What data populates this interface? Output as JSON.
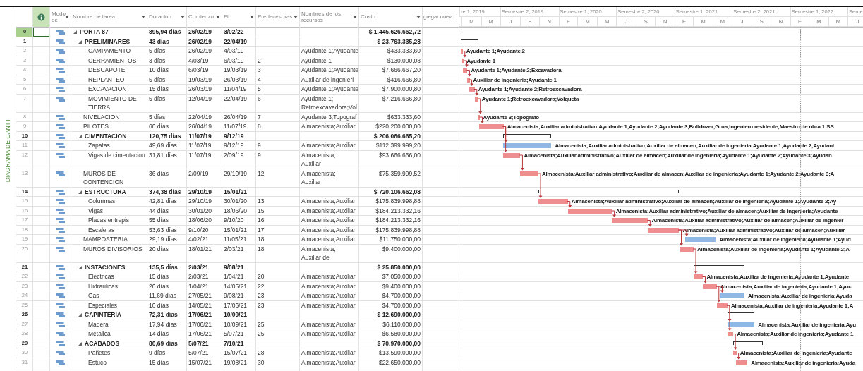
{
  "side_label": "DIAGRAMA DE GANTT",
  "columns": [
    {
      "label": "Modo de",
      "dropdown": true
    },
    {
      "label": "Nombre de tarea",
      "dropdown": true
    },
    {
      "label": "Duración",
      "dropdown": true
    },
    {
      "label": "Comienzo",
      "dropdown": true
    },
    {
      "label": "Fin",
      "dropdown": true
    },
    {
      "label": "Predecesoras",
      "dropdown": true
    },
    {
      "label": "Nombres de los recursos",
      "dropdown": true
    },
    {
      "label": "Costo",
      "dropdown": true
    },
    {
      "label": "gregar nuevo",
      "dropdown": false
    }
  ],
  "timescale": {
    "semesters": [
      "re 1, 2019",
      "Semestre 2, 2019",
      "Semestre 1, 2020",
      "Semestre 2, 2020",
      "Semestre 1, 2021",
      "Semestre 2, 2021",
      "Semestre 1, 2022",
      "Seme"
    ],
    "months": [
      "M",
      "M",
      "J",
      "S",
      "N",
      "E",
      "M",
      "M",
      "J",
      "S",
      "N",
      "E",
      "M",
      "M",
      "J",
      "S",
      "N",
      "E",
      "M",
      "M",
      "J"
    ]
  },
  "tasks": [
    {
      "id": "0",
      "kind": "project",
      "name": "PORTA 87",
      "duration": "895,94 días",
      "start": "26/02/19",
      "finish": "3/02/22",
      "cost": "$ 1.445.626.662,72",
      "expanded": true,
      "selected": true,
      "children": [
        {
          "id": "1",
          "kind": "summary",
          "name": "PRELIMINARES",
          "duration": "43 días",
          "start": "26/02/19",
          "finish": "22/04/19",
          "cost": "$ 23.763.335,28",
          "expanded": true,
          "selected": false,
          "children": [
            {
              "id": "2",
              "kind": "task",
              "name": "CAMPAMENTO",
              "duration": "5 días",
              "start": "26/02/19",
              "finish": "4/03/19",
              "resources": "Ayudante 1;Ayudante",
              "cost": "$433.333,60",
              "critical": true,
              "selected": false,
              "bar_label": "Ayudante 1;Ayudante 2"
            },
            {
              "id": "3",
              "kind": "task",
              "name": "CERRAMIENTOS",
              "duration": "3 días",
              "start": "4/03/19",
              "finish": "6/03/19",
              "predecessors": "2",
              "resources": "Ayudante 1",
              "cost": "$130.000,08",
              "critical": true,
              "selected": false,
              "bar_label": "Ayudante 1"
            },
            {
              "id": "4",
              "kind": "task",
              "name": "DESCAPOTE",
              "duration": "10 días",
              "start": "6/03/19",
              "finish": "19/03/19",
              "predecessors": "3",
              "resources": "Ayudante 1;Ayudante",
              "cost": "$7.666.667,20",
              "critical": true,
              "selected": false,
              "bar_label": "Ayudante 1;Ayudante 2;Excavadora"
            },
            {
              "id": "5",
              "kind": "task",
              "name": "REPLANTEO",
              "duration": "5 días",
              "start": "19/03/19",
              "finish": "26/03/19",
              "predecessors": "4",
              "resources": "Auxiliar de ingenieri",
              "cost": "$416.666,80",
              "critical": true,
              "selected": false,
              "bar_label": "Auxiliar de ingenieria;Ayudante 1"
            },
            {
              "id": "6",
              "kind": "task",
              "name": "EXCAVACION",
              "duration": "15 días",
              "start": "26/03/19",
              "finish": "11/04/19",
              "predecessors": "5",
              "resources": "Ayudante 1;Ayudante",
              "cost": "$7.900.000,80",
              "critical": true,
              "selected": false,
              "bar_label": "Ayudante 1;Ayudante 2;Retroexcavadora"
            },
            {
              "id": "7",
              "kind": "task",
              "name": "MOVIMIENTO DE TIERRA",
              "duration": "5 días",
              "start": "12/04/19",
              "finish": "22/04/19",
              "predecessors": "6",
              "resources": "Ayudante 1;\nRetroexcavadora;Vol",
              "cost": "$7.216.666,80",
              "critical": true,
              "selected": false,
              "bar_label": "Ayudante 1;Retroexcavadora;Volqueta"
            }
          ]
        },
        {
          "id": "8",
          "kind": "task",
          "name": "NIVELACION",
          "duration": "5 días",
          "start": "22/04/19",
          "finish": "26/04/19",
          "predecessors": "7",
          "resources": "Ayudante 3;Topograf",
          "cost": "$633.333,60",
          "critical": true,
          "selected": false,
          "bar_label": "Ayudante 3;Topografo"
        },
        {
          "id": "9",
          "kind": "task",
          "name": "PILOTES",
          "duration": "60 días",
          "start": "26/04/19",
          "finish": "11/07/19",
          "predecessors": "8",
          "resources": "Almacenista;Auxiliar",
          "cost": "$220.200.000,00",
          "critical": true,
          "selected": false,
          "bar_label": "Almacenista;Auxiliar administrativo;Ayudante 1;Ayudante 2;Ayudante 3;Bulldozer;Grua;Ingeniero residente;Maestro de obra 1;SS"
        },
        {
          "id": "10",
          "kind": "summary",
          "name": "CIMENTACION",
          "duration": "120,75 días",
          "start": "11/07/19",
          "finish": "9/12/19",
          "cost": "$ 206.066.665,20",
          "expanded": true,
          "selected": false,
          "children": [
            {
              "id": "11",
              "kind": "task",
              "name": "Zapatas",
              "duration": "49,69 días",
              "start": "11/07/19",
              "finish": "9/12/19",
              "predecessors": "9",
              "resources": "Almacenista;Auxiliar",
              "cost": "$112.399.999,20",
              "critical": false,
              "selected": false,
              "bar_label": "Almacenista;Auxiliar administrativo;Auxiliar de almacen;Auxiliar de ingenieria;Ayudante 1;Ayudante 2;Ayudant"
            },
            {
              "id": "12",
              "kind": "task",
              "name": "Vigas de cimentacion",
              "duration": "31,81 días",
              "start": "11/07/19",
              "finish": "2/09/19",
              "predecessors": "9",
              "resources": "Almacenista;\nAuxiliar",
              "cost": "$93.666.666,00",
              "critical": true,
              "selected": false,
              "bar_label": "Almacenista;Auxiliar administrativo;Auxiliar de almacen;Auxiliar de ingenieria;Ayudante 1;Ayudante 2;Ayudante 3;Ayudan"
            }
          ]
        },
        {
          "id": "13",
          "kind": "task",
          "name": "MUROS DE CONTENCION",
          "duration": "36 días",
          "start": "2/09/19",
          "finish": "29/10/19",
          "predecessors": "12",
          "resources": "Almacenista;\nAuxiliar",
          "cost": "$75.359.999,52",
          "critical": true,
          "selected": false,
          "bar_label": "Almacenista;Auxiliar administrativo;Auxiliar de almacen;Auxiliar de ingenieria;Ayudante 1;Ayudante 2;Ayudante 3;A"
        },
        {
          "id": "14",
          "kind": "summary",
          "name": "ESTRUCTURA",
          "duration": "374,38 días",
          "start": "29/10/19",
          "finish": "15/01/21",
          "cost": "$ 720.106.662,08",
          "expanded": true,
          "selected": false,
          "children": [
            {
              "id": "15",
              "kind": "task",
              "name": "Columnas",
              "duration": "42,81 días",
              "start": "29/10/19",
              "finish": "30/01/20",
              "predecessors": "13",
              "resources": "Almacenista;Auxiliar",
              "cost": "$175.839.998,88",
              "critical": true,
              "selected": false,
              "bar_label": "Almacenista;Auxiliar administrativo;Auxiliar de almacen;Auxiliar de ingenieria;Ayudante 1;Ayudante 2;Ay"
            },
            {
              "id": "16",
              "kind": "task",
              "name": "Vigas",
              "duration": "44 días",
              "start": "30/01/20",
              "finish": "18/06/20",
              "predecessors": "15",
              "resources": "Almacenista;Auxiliar",
              "cost": "$184.213.332,16",
              "critical": true,
              "selected": false,
              "bar_label": "Almacenista;Auxiliar administrativo;Auxiliar de almacen;Auxiliar de ingenieria;Ayudante"
            },
            {
              "id": "17",
              "kind": "task",
              "name": "Placas entrepis",
              "duration": "55 días",
              "start": "18/06/20",
              "finish": "9/10/20",
              "predecessors": "16",
              "resources": "Almacenista;Auxiliar",
              "cost": "$184.213.332,16",
              "critical": true,
              "selected": false,
              "bar_label": "Almacenista;Auxiliar administrativo;Auxiliar de almacen;Auxiliar de ingenier"
            },
            {
              "id": "18",
              "kind": "task",
              "name": "Escaleras",
              "duration": "53,63 días",
              "start": "9/10/20",
              "finish": "15/01/21",
              "predecessors": "17",
              "resources": "Almacenista;Auxiliar",
              "cost": "$175.839.998,88",
              "critical": true,
              "selected": false,
              "bar_label": "Almacenista;Auxiliar administrativo;Auxiliar de almacen;Auxiliar"
            }
          ]
        },
        {
          "id": "19",
          "kind": "task",
          "name": "MAMPOSTERIA",
          "duration": "29,19 días",
          "start": "4/02/21",
          "finish": "11/05/21",
          "predecessors": "18",
          "resources": "Almacenista;Auxiliar",
          "cost": "$11.750.000,00",
          "critical": false,
          "selected": false,
          "bar_label": "Almacenista;Auxiliar de ingenieria;Ayudante 1;Ayud"
        },
        {
          "id": "20",
          "kind": "task",
          "name": "MUROS DIVISORIOS",
          "duration": "20 días",
          "start": "18/01/21",
          "finish": "2/03/21",
          "predecessors": "18",
          "resources": "Almacenista;\nAuxiliar de",
          "cost": "$9.400.000,00",
          "critical": true,
          "selected": false,
          "bar_label": "Almacenista;Auxiliar de ingenieria;Ayudante 1;Ayudante 2;A"
        },
        {
          "id": "21",
          "kind": "summary",
          "name": "INSTACIONES",
          "duration": "135,5 días",
          "start": "2/03/21",
          "finish": "9/08/21",
          "cost": "$ 25.850.000,00",
          "expanded": true,
          "selected": false,
          "children": [
            {
              "id": "22",
              "kind": "task",
              "name": "Electricas",
              "duration": "15 días",
              "start": "2/03/21",
              "finish": "1/04/21",
              "predecessors": "20",
              "resources": "Almacenista;Auxiliar",
              "cost": "$7.050.000,00",
              "critical": true,
              "selected": false,
              "bar_label": "Almacenista;Auxiliar de ingenieria;Ayudante 1;Ayudante"
            },
            {
              "id": "23",
              "kind": "task",
              "name": "Hidraulicas",
              "duration": "20 días",
              "start": "1/04/21",
              "finish": "14/05/21",
              "predecessors": "22",
              "resources": "Almacenista;Auxiliar",
              "cost": "$9.400.000,00",
              "critical": true,
              "selected": false,
              "bar_label": "Almacenista;Auxiliar de ingenieria;Ayudante 1;Ayuc"
            },
            {
              "id": "24",
              "kind": "task",
              "name": "Gas",
              "duration": "11,69 días",
              "start": "27/05/21",
              "finish": "9/08/21",
              "predecessors": "23",
              "resources": "Almacenista;Auxiliar",
              "cost": "$4.700.000,00",
              "critical": false,
              "selected": false,
              "bar_label": "Almacenista;Auxiliar de ingenieria;Ayuda"
            },
            {
              "id": "25",
              "kind": "task",
              "name": "Especiales",
              "duration": "10 días",
              "start": "14/05/21",
              "finish": "17/06/21",
              "predecessors": "23",
              "resources": "Almacenista;Auxiliar",
              "cost": "$4.700.000,00",
              "critical": true,
              "selected": false,
              "bar_label": "Almacenista;Auxiliar de ingenieria;Ayudante 1;A"
            }
          ]
        },
        {
          "id": "26",
          "kind": "summary",
          "name": "CAPINTERIA",
          "duration": "72,31 días",
          "start": "17/06/21",
          "finish": "10/09/21",
          "cost": "$ 12.690.000,00",
          "expanded": true,
          "selected": false,
          "children": [
            {
              "id": "27",
              "kind": "task",
              "name": "Madera",
              "duration": "17,94 días",
              "start": "17/06/21",
              "finish": "10/09/21",
              "predecessors": "25",
              "resources": "Almacenista;Auxiliar",
              "cost": "$6.110.000,00",
              "critical": false,
              "selected": false,
              "bar_label": "Almacenista;Auxiliar de ingenieria;Ayu"
            },
            {
              "id": "28",
              "kind": "task",
              "name": "Metalica",
              "duration": "14 días",
              "start": "17/06/21",
              "finish": "5/07/21",
              "predecessors": "25",
              "resources": "Almacenista;Auxiliar",
              "cost": "$6.580.000,00",
              "critical": true,
              "selected": false,
              "bar_label": "Almacenista;Auxiliar de ingenieria;Ayudante 1"
            }
          ]
        },
        {
          "id": "29",
          "kind": "summary",
          "name": "ACABADOS",
          "duration": "80,69 días",
          "start": "5/07/21",
          "finish": "7/10/21",
          "cost": "$ 70.970.000,00",
          "expanded": true,
          "selected": false,
          "children": [
            {
              "id": "30",
              "kind": "task",
              "name": "Pañetes",
              "duration": "9 días",
              "start": "5/07/21",
              "finish": "15/07/21",
              "predecessors": "28",
              "resources": "Almacenista;Auxiliar",
              "cost": "$13.590.000,00",
              "critical": true,
              "selected": false,
              "bar_label": "Almacenista;Auxiliar de ingenieria;Ayudante"
            },
            {
              "id": "31",
              "kind": "task",
              "name": "Estuco",
              "duration": "15 días",
              "start": "15/07/21",
              "finish": "19/08/21",
              "predecessors": "30",
              "resources": "Almacenista;Auxiliar",
              "cost": "$22.650.000,00",
              "critical": true,
              "selected": false,
              "bar_label": "Almacenista;Auxiliar de ingenieria;Ayuda"
            }
          ]
        }
      ]
    }
  ]
}
